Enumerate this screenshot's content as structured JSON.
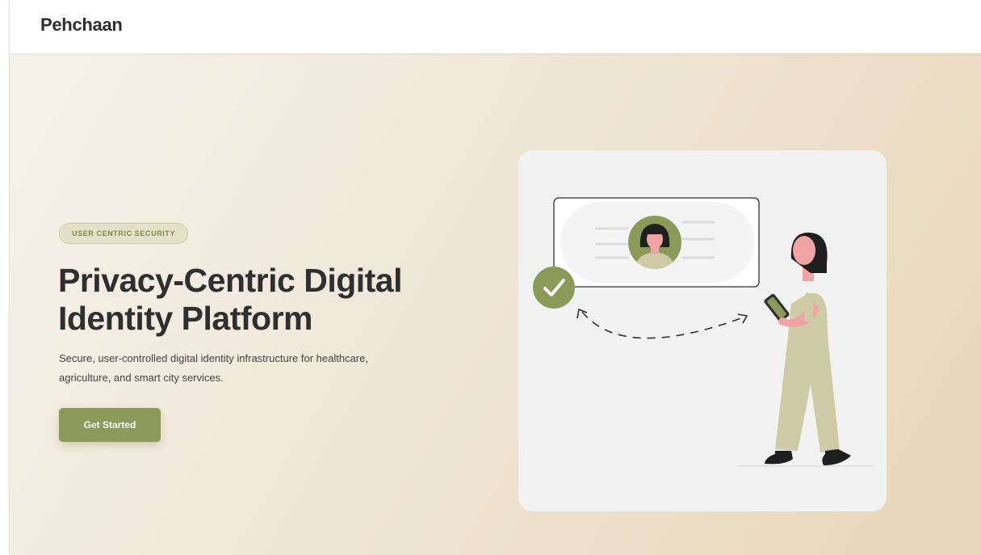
{
  "navbar": {
    "brand": "Pehchaan"
  },
  "hero": {
    "badge": "USER CENTRIC SECURITY",
    "title": "Privacy-Centric Digital Identity Platform",
    "subtitle": "Secure, user-controlled digital identity infrastructure for healthcare, agriculture, and smart city services.",
    "cta_label": "Get Started"
  },
  "illustration": {
    "icons": [
      "id-card-icon",
      "avatar-icon",
      "check-circle-icon",
      "phone-icon",
      "person-figure"
    ]
  },
  "colors": {
    "accent": "#8b9a58",
    "badge_bg": "#e3e1c8",
    "badge_text": "#7b8a4c",
    "heading": "#2f2f2f",
    "dress": "#cfcaa6",
    "skin": "#f0a3a3"
  }
}
